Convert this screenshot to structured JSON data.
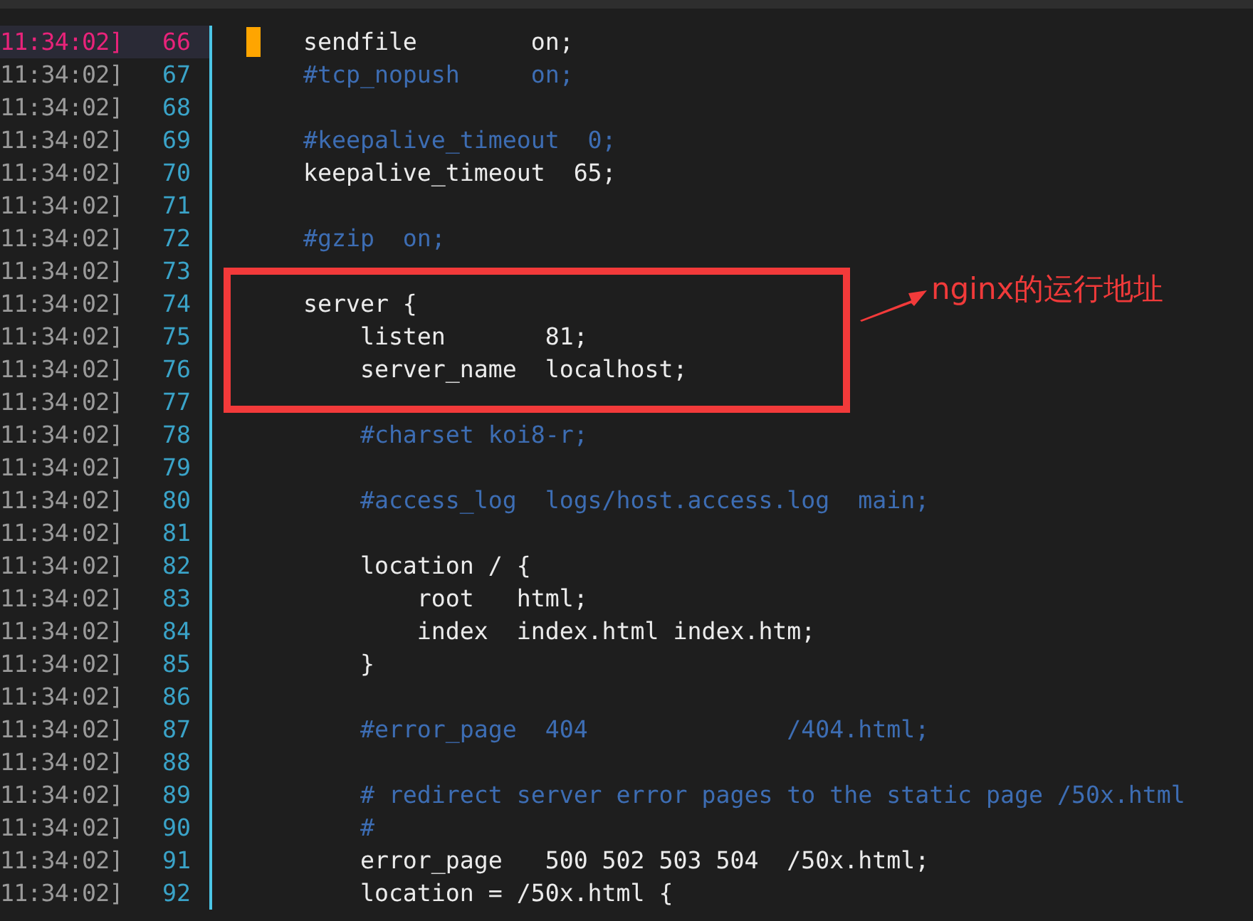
{
  "editor": {
    "lines": [
      {
        "time": "11:34:02]",
        "number": "66",
        "kind": "code",
        "text": "sendfile        on;",
        "selected": true
      },
      {
        "time": "11:34:02]",
        "number": "67",
        "kind": "comment",
        "text": "#tcp_nopush     on;",
        "selected": false
      },
      {
        "time": "11:34:02]",
        "number": "68",
        "kind": "blank",
        "selected": false
      },
      {
        "time": "11:34:02]",
        "number": "69",
        "kind": "comment",
        "text": "#keepalive_timeout  0;",
        "selected": false
      },
      {
        "time": "11:34:02]",
        "number": "70",
        "kind": "code",
        "text": "keepalive_timeout  65;",
        "selected": false
      },
      {
        "time": "11:34:02]",
        "number": "71",
        "kind": "blank",
        "selected": false
      },
      {
        "time": "11:34:02]",
        "number": "72",
        "kind": "comment",
        "text": "#gzip  on;",
        "selected": false
      },
      {
        "time": "11:34:02]",
        "number": "73",
        "kind": "blank",
        "selected": false
      },
      {
        "time": "11:34:02]",
        "number": "74",
        "kind": "code",
        "text": "server {",
        "selected": false
      },
      {
        "time": "11:34:02]",
        "number": "75",
        "kind": "code",
        "text": "    listen       81;",
        "selected": false
      },
      {
        "time": "11:34:02]",
        "number": "76",
        "kind": "code",
        "text": "    server_name  localhost;",
        "selected": false
      },
      {
        "time": "11:34:02]",
        "number": "77",
        "kind": "blank",
        "selected": false
      },
      {
        "time": "11:34:02]",
        "number": "78",
        "kind": "comment",
        "text": "    #charset koi8-r;",
        "selected": false
      },
      {
        "time": "11:34:02]",
        "number": "79",
        "kind": "blank",
        "selected": false
      },
      {
        "time": "11:34:02]",
        "number": "80",
        "kind": "comment",
        "text": "    #access_log  logs/host.access.log  main;",
        "selected": false
      },
      {
        "time": "11:34:02]",
        "number": "81",
        "kind": "blank",
        "selected": false
      },
      {
        "time": "11:34:02]",
        "number": "82",
        "kind": "code",
        "text": "    location / {",
        "selected": false
      },
      {
        "time": "11:34:02]",
        "number": "83",
        "kind": "code",
        "text": "        root   html;",
        "selected": false
      },
      {
        "time": "11:34:02]",
        "number": "84",
        "kind": "code",
        "text": "        index  index.html index.htm;",
        "selected": false
      },
      {
        "time": "11:34:02]",
        "number": "85",
        "kind": "code",
        "text": "    }",
        "selected": false
      },
      {
        "time": "11:34:02]",
        "number": "86",
        "kind": "blank",
        "selected": false
      },
      {
        "time": "11:34:02]",
        "number": "87",
        "kind": "comment",
        "text": "    #error_page  404              /404.html;",
        "selected": false
      },
      {
        "time": "11:34:02]",
        "number": "88",
        "kind": "blank",
        "selected": false
      },
      {
        "time": "11:34:02]",
        "number": "89",
        "kind": "comment",
        "text": "    # redirect server error pages to the static page /50x.html",
        "selected": false
      },
      {
        "time": "11:34:02]",
        "number": "90",
        "kind": "comment",
        "text": "    #",
        "selected": false
      },
      {
        "time": "11:34:02]",
        "number": "91",
        "kind": "code",
        "text": "    error_page   500 502 503 504  /50x.html;",
        "selected": false
      },
      {
        "time": "11:34:02]",
        "number": "92",
        "kind": "code",
        "text": "    location = /50x.html {",
        "selected": false
      }
    ]
  },
  "annotation": {
    "label": "nginx的运行地址"
  }
}
